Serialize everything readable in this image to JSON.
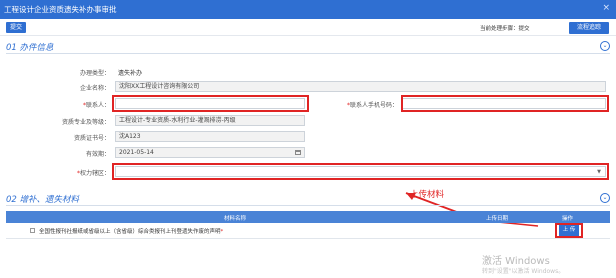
{
  "window": {
    "title": "工程设计企业资质遗失补办事审批",
    "close_glyph": "×"
  },
  "toolbar": {
    "submit_label": "提交",
    "step_label": "当前处理步骤：提交",
    "flow_label": "流程追踪"
  },
  "section1": {
    "title": "01 办件信息",
    "toggle_glyph": "⌄"
  },
  "form": {
    "type_label": "办理类型：",
    "type_value": "遗失补办",
    "company_label": "企业名称：",
    "company_value": "沈阳XX工程设计咨询有限公司",
    "contact_label": "联系人：",
    "contact_value": "",
    "phone_label": "联系人手机号码：",
    "phone_value": "",
    "qualification_label": "资质专业及等级：",
    "qualification_value": "工程设计-专业资质-水利行业-灌溉排涝-丙级",
    "cert_label": "资质证书号：",
    "cert_value": "沈A123",
    "valid_label": "有效期：",
    "valid_value": "2021-05-14",
    "area_label": "权力辖区：",
    "area_value": "",
    "required_mark": "*"
  },
  "annotation": {
    "text": "上传材料"
  },
  "section2": {
    "title": "02 增补、遗失材料",
    "toggle_glyph": "⌄"
  },
  "table": {
    "headers": [
      "材料名称",
      "上传日期",
      "操作"
    ],
    "rows": [
      {
        "name": "全国性报刊社报纸或省级以上（含省级）综合类报刊上刊登遗失作废的声明",
        "required": "*",
        "date": "",
        "action": "上 传"
      }
    ]
  },
  "watermark": {
    "line1": "激活 Windows",
    "line2": "转到\"设置\"以激活 Windows。"
  },
  "colors": {
    "accent": "#2f6fd2",
    "highlight": "#e02424"
  }
}
